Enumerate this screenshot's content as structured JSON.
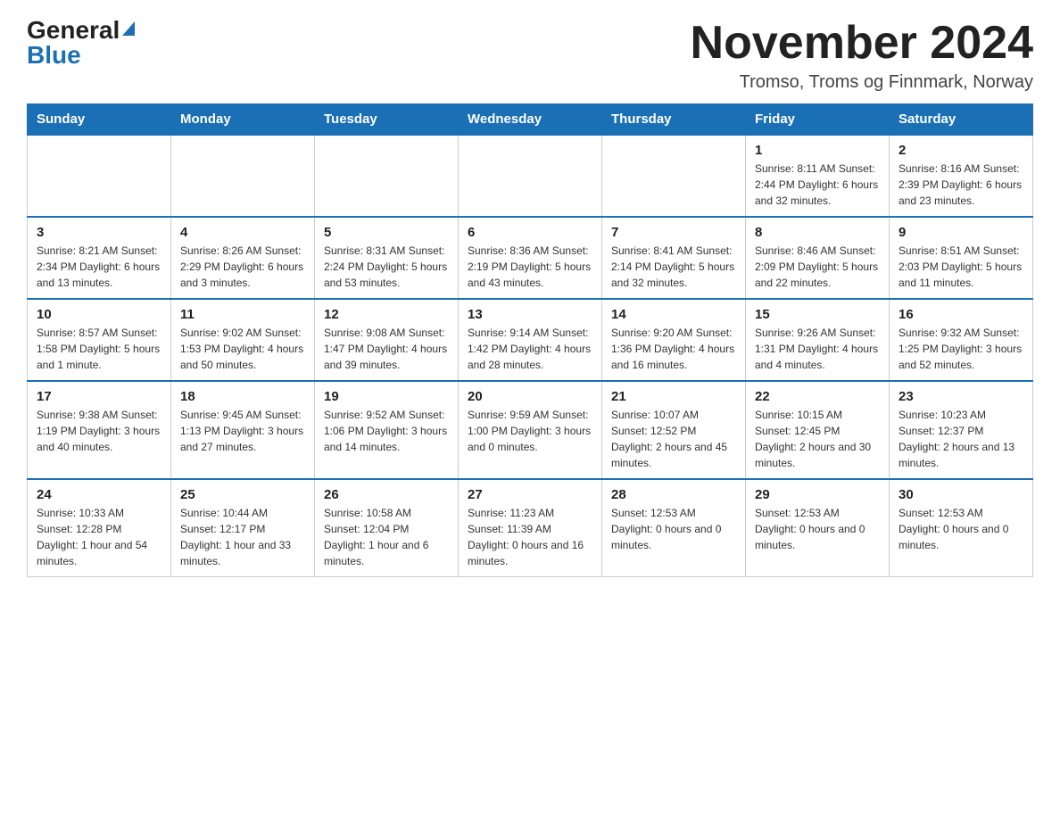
{
  "header": {
    "title": "November 2024",
    "subtitle": "Tromso, Troms og Finnmark, Norway",
    "logo_general": "General",
    "logo_blue": "Blue"
  },
  "days_of_week": [
    "Sunday",
    "Monday",
    "Tuesday",
    "Wednesday",
    "Thursday",
    "Friday",
    "Saturday"
  ],
  "weeks": [
    [
      {
        "day": "",
        "info": ""
      },
      {
        "day": "",
        "info": ""
      },
      {
        "day": "",
        "info": ""
      },
      {
        "day": "",
        "info": ""
      },
      {
        "day": "",
        "info": ""
      },
      {
        "day": "1",
        "info": "Sunrise: 8:11 AM\nSunset: 2:44 PM\nDaylight: 6 hours and 32 minutes."
      },
      {
        "day": "2",
        "info": "Sunrise: 8:16 AM\nSunset: 2:39 PM\nDaylight: 6 hours and 23 minutes."
      }
    ],
    [
      {
        "day": "3",
        "info": "Sunrise: 8:21 AM\nSunset: 2:34 PM\nDaylight: 6 hours and 13 minutes."
      },
      {
        "day": "4",
        "info": "Sunrise: 8:26 AM\nSunset: 2:29 PM\nDaylight: 6 hours and 3 minutes."
      },
      {
        "day": "5",
        "info": "Sunrise: 8:31 AM\nSunset: 2:24 PM\nDaylight: 5 hours and 53 minutes."
      },
      {
        "day": "6",
        "info": "Sunrise: 8:36 AM\nSunset: 2:19 PM\nDaylight: 5 hours and 43 minutes."
      },
      {
        "day": "7",
        "info": "Sunrise: 8:41 AM\nSunset: 2:14 PM\nDaylight: 5 hours and 32 minutes."
      },
      {
        "day": "8",
        "info": "Sunrise: 8:46 AM\nSunset: 2:09 PM\nDaylight: 5 hours and 22 minutes."
      },
      {
        "day": "9",
        "info": "Sunrise: 8:51 AM\nSunset: 2:03 PM\nDaylight: 5 hours and 11 minutes."
      }
    ],
    [
      {
        "day": "10",
        "info": "Sunrise: 8:57 AM\nSunset: 1:58 PM\nDaylight: 5 hours and 1 minute."
      },
      {
        "day": "11",
        "info": "Sunrise: 9:02 AM\nSunset: 1:53 PM\nDaylight: 4 hours and 50 minutes."
      },
      {
        "day": "12",
        "info": "Sunrise: 9:08 AM\nSunset: 1:47 PM\nDaylight: 4 hours and 39 minutes."
      },
      {
        "day": "13",
        "info": "Sunrise: 9:14 AM\nSunset: 1:42 PM\nDaylight: 4 hours and 28 minutes."
      },
      {
        "day": "14",
        "info": "Sunrise: 9:20 AM\nSunset: 1:36 PM\nDaylight: 4 hours and 16 minutes."
      },
      {
        "day": "15",
        "info": "Sunrise: 9:26 AM\nSunset: 1:31 PM\nDaylight: 4 hours and 4 minutes."
      },
      {
        "day": "16",
        "info": "Sunrise: 9:32 AM\nSunset: 1:25 PM\nDaylight: 3 hours and 52 minutes."
      }
    ],
    [
      {
        "day": "17",
        "info": "Sunrise: 9:38 AM\nSunset: 1:19 PM\nDaylight: 3 hours and 40 minutes."
      },
      {
        "day": "18",
        "info": "Sunrise: 9:45 AM\nSunset: 1:13 PM\nDaylight: 3 hours and 27 minutes."
      },
      {
        "day": "19",
        "info": "Sunrise: 9:52 AM\nSunset: 1:06 PM\nDaylight: 3 hours and 14 minutes."
      },
      {
        "day": "20",
        "info": "Sunrise: 9:59 AM\nSunset: 1:00 PM\nDaylight: 3 hours and 0 minutes."
      },
      {
        "day": "21",
        "info": "Sunrise: 10:07 AM\nSunset: 12:52 PM\nDaylight: 2 hours and 45 minutes."
      },
      {
        "day": "22",
        "info": "Sunrise: 10:15 AM\nSunset: 12:45 PM\nDaylight: 2 hours and 30 minutes."
      },
      {
        "day": "23",
        "info": "Sunrise: 10:23 AM\nSunset: 12:37 PM\nDaylight: 2 hours and 13 minutes."
      }
    ],
    [
      {
        "day": "24",
        "info": "Sunrise: 10:33 AM\nSunset: 12:28 PM\nDaylight: 1 hour and 54 minutes."
      },
      {
        "day": "25",
        "info": "Sunrise: 10:44 AM\nSunset: 12:17 PM\nDaylight: 1 hour and 33 minutes."
      },
      {
        "day": "26",
        "info": "Sunrise: 10:58 AM\nSunset: 12:04 PM\nDaylight: 1 hour and 6 minutes."
      },
      {
        "day": "27",
        "info": "Sunrise: 11:23 AM\nSunset: 11:39 AM\nDaylight: 0 hours and 16 minutes."
      },
      {
        "day": "28",
        "info": "\nSunset: 12:53 AM\nDaylight: 0 hours and 0 minutes."
      },
      {
        "day": "29",
        "info": "\nSunset: 12:53 AM\nDaylight: 0 hours and 0 minutes."
      },
      {
        "day": "30",
        "info": "\nSunset: 12:53 AM\nDaylight: 0 hours and 0 minutes."
      }
    ]
  ]
}
